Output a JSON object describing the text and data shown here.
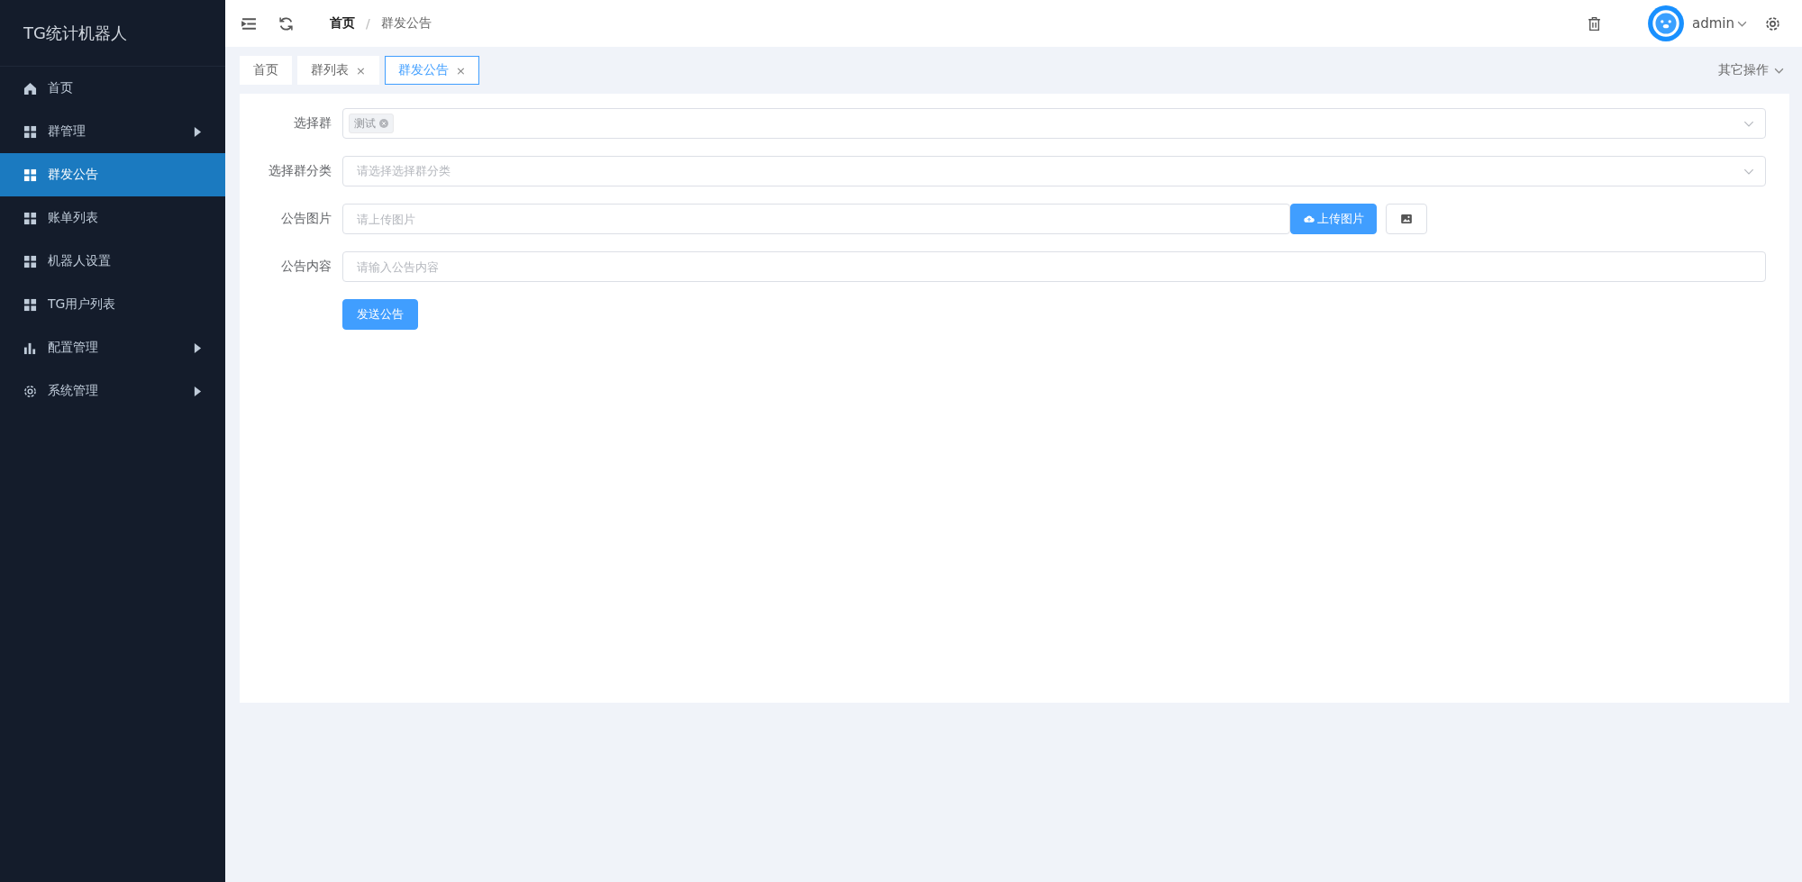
{
  "sidebar": {
    "title": "TG统计机器人",
    "items": [
      {
        "label": "首页",
        "selected": false
      },
      {
        "label": "群管理",
        "selected": false,
        "expanded": false
      },
      {
        "label": "群发公告",
        "selected": true
      },
      {
        "label": "账单列表",
        "selected": false
      },
      {
        "label": "机器人设置",
        "selected": false
      },
      {
        "label": "TG用户列表",
        "selected": false
      },
      {
        "label": "配置管理",
        "selected": false,
        "expanded": false
      },
      {
        "label": "系统管理",
        "selected": false,
        "expanded": false
      }
    ]
  },
  "header": {
    "breadcrumb": [
      {
        "label": "首页",
        "current": false
      },
      {
        "label": "群发公告",
        "current": true
      }
    ],
    "separator": "/",
    "user": "admin"
  },
  "tabs": [
    {
      "label": "首页",
      "selected": false
    },
    {
      "label": "群列表",
      "selected": false,
      "close": "×"
    },
    {
      "label": "群发公告",
      "selected": true,
      "close": "×"
    }
  ],
  "other_actions": "其它操作",
  "form": {
    "fields": [
      {
        "kind": "multiselect",
        "label": "选择群",
        "tags": [
          "测试"
        ]
      },
      {
        "kind": "select",
        "label": "选择群分类",
        "placeholder": "请选择选择群分类"
      },
      {
        "kind": "upload",
        "label": "公告图片",
        "placeholder": "请上传图片",
        "button": "上传图片"
      },
      {
        "kind": "text",
        "label": "公告内容",
        "placeholder": "请输入公告内容"
      }
    ],
    "submit": "发送公告"
  }
}
